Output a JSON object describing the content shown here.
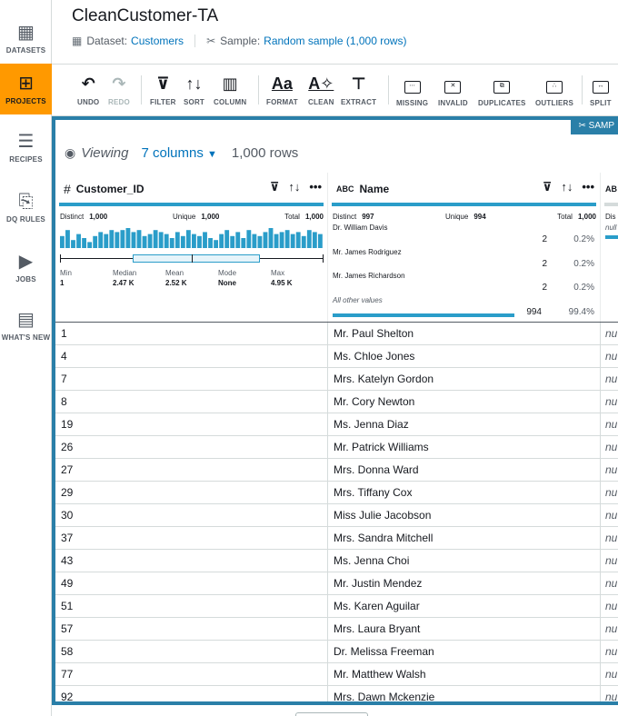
{
  "nav": [
    {
      "label": "DATASETS",
      "icon": "grid-icon",
      "glyph": "▦",
      "active": false
    },
    {
      "label": "PROJECTS",
      "icon": "project-grid-icon",
      "glyph": "⊞",
      "active": true
    },
    {
      "label": "RECIPES",
      "icon": "list-icon",
      "glyph": "☰",
      "active": false
    },
    {
      "label": "DQ RULES",
      "icon": "badge-icon",
      "glyph": "⎘",
      "active": false
    },
    {
      "label": "JOBS",
      "icon": "play-icon",
      "glyph": "▶",
      "active": false
    },
    {
      "label": "WHAT'S NEW",
      "icon": "news-icon",
      "glyph": "▤",
      "active": false
    }
  ],
  "header": {
    "title": "CleanCustomer-TA",
    "dataset_label": "Dataset:",
    "dataset_value": "Customers",
    "sample_label": "Sample:",
    "sample_value": "Random sample (1,000 rows)"
  },
  "toolbar": {
    "undo": "UNDO",
    "redo": "REDO",
    "filter": "FILTER",
    "sort": "SORT",
    "column": "COLUMN",
    "format": "FORMAT",
    "clean": "CLEAN",
    "extract": "EXTRACT",
    "missing": "MISSING",
    "invalid": "INVALID",
    "duplicates": "DUPLICATES",
    "outliers": "OUTLIERS",
    "split": "SPLIT"
  },
  "panel": {
    "sample_badge": "SAMP",
    "viewing": "Viewing",
    "columns": "7 columns",
    "rows": "1,000 rows"
  },
  "col1": {
    "type": "#",
    "name": "Customer_ID",
    "distinct_label": "Distinct",
    "distinct": "1,000",
    "unique_label": "Unique",
    "unique": "1,000",
    "total_label": "Total",
    "total": "1,000",
    "histogram": [
      0.6,
      0.9,
      0.4,
      0.7,
      0.5,
      0.3,
      0.6,
      0.8,
      0.7,
      0.9,
      0.8,
      0.9,
      1.0,
      0.8,
      0.9,
      0.6,
      0.7,
      0.9,
      0.8,
      0.7,
      0.5,
      0.8,
      0.6,
      0.9,
      0.7,
      0.6,
      0.8,
      0.5,
      0.4,
      0.7,
      0.9,
      0.6,
      0.8,
      0.5,
      0.9,
      0.7,
      0.6,
      0.8,
      1.0,
      0.7,
      0.8,
      0.9,
      0.7,
      0.8,
      0.6,
      0.9,
      0.8,
      0.7
    ],
    "summary": [
      {
        "label": "Min",
        "value": "1"
      },
      {
        "label": "Median",
        "value": "2.47 K"
      },
      {
        "label": "Mean",
        "value": "2.52 K"
      },
      {
        "label": "Mode",
        "value": "None"
      },
      {
        "label": "Max",
        "value": "4.95 K"
      }
    ]
  },
  "col2": {
    "type": "ABC",
    "name": "Name",
    "distinct_label": "Distinct",
    "distinct": "997",
    "unique_label": "Unique",
    "unique": "994",
    "total_label": "Total",
    "total": "1,000",
    "top_values": [
      {
        "value": "Dr. William Davis",
        "count": "2",
        "pct": "0.2%"
      },
      {
        "value": "Mr. James Rodriguez",
        "count": "2",
        "pct": "0.2%"
      },
      {
        "value": "Mr. James Richardson",
        "count": "2",
        "pct": "0.2%"
      }
    ],
    "other_label": "All other values",
    "other_count": "994",
    "other_pct": "99.4%"
  },
  "col3": {
    "type": "AB",
    "distinct_label": "Dis",
    "null_label": "null"
  },
  "rows": [
    {
      "id": "1",
      "name": "Mr. Paul Shelton",
      "c3": "nu"
    },
    {
      "id": "4",
      "name": "Ms. Chloe Jones",
      "c3": "nu"
    },
    {
      "id": "7",
      "name": "Mrs. Katelyn Gordon",
      "c3": "nu"
    },
    {
      "id": "8",
      "name": "Mr. Cory Newton",
      "c3": "nu"
    },
    {
      "id": "19",
      "name": "Ms. Jenna Diaz",
      "c3": "nu"
    },
    {
      "id": "26",
      "name": "Mr. Patrick Williams",
      "c3": "nu"
    },
    {
      "id": "27",
      "name": "Mrs. Donna Ward",
      "c3": "nu"
    },
    {
      "id": "29",
      "name": "Mrs. Tiffany Cox",
      "c3": "nu"
    },
    {
      "id": "30",
      "name": "Miss Julie Jacobson",
      "c3": "nu"
    },
    {
      "id": "37",
      "name": "Mrs. Sandra Mitchell",
      "c3": "nu"
    },
    {
      "id": "43",
      "name": "Ms. Jenna Choi",
      "c3": "nu"
    },
    {
      "id": "49",
      "name": "Mr. Justin Mendez",
      "c3": "nu"
    },
    {
      "id": "51",
      "name": "Ms. Karen Aguilar",
      "c3": "nu"
    },
    {
      "id": "57",
      "name": "Mrs. Laura Bryant",
      "c3": "nu"
    },
    {
      "id": "58",
      "name": "Dr. Melissa Freeman",
      "c3": "nu"
    },
    {
      "id": "77",
      "name": "Mr. Matthew Walsh",
      "c3": "nu"
    },
    {
      "id": "92",
      "name": "Mrs. Dawn Mckenzie",
      "c3": "nu"
    }
  ],
  "colors": {
    "accent": "#ff9900",
    "panel_border": "#2a7fa8",
    "bar": "#2a9dc9",
    "link": "#0073bb"
  }
}
